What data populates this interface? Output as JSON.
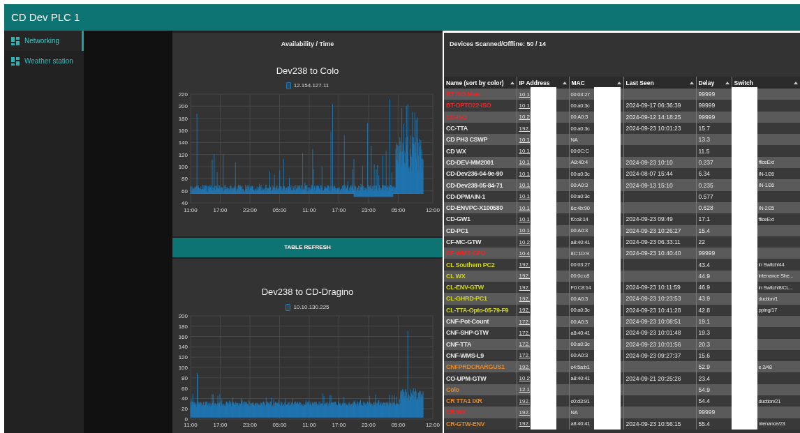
{
  "header": {
    "title": "CD Dev PLC 1"
  },
  "sidebar": {
    "items": [
      {
        "label": "Networking",
        "selected": true
      },
      {
        "label": "Weather station",
        "selected": false
      }
    ]
  },
  "availability": {
    "heading": "Availability / Time",
    "charts": [
      {
        "title": "Dev238 to Colo",
        "legend": "12.154.127.11",
        "yticks": [
          "220",
          "200",
          "180",
          "160",
          "140",
          "120",
          "100",
          "80",
          "60",
          "40"
        ],
        "xticks": [
          "11:00",
          "17:00",
          "23:00",
          "05:00",
          "11:00",
          "17:00",
          "23:00",
          "05:00",
          "12:00"
        ],
        "kind": "spiky"
      },
      {
        "title": "Dev238 to CD-Dragino",
        "legend": "10.10.130.225",
        "yticks": [
          "200",
          "180",
          "160",
          "140",
          "120",
          "100",
          "80",
          "60",
          "40",
          "20",
          "0"
        ],
        "xticks": [
          "11:00",
          "17:00",
          "23:00",
          "05:00",
          "11:00",
          "17:00",
          "23:00",
          "05:00",
          "12:00"
        ],
        "kind": "dense"
      }
    ],
    "refresh_button": "TABLE REFRESH"
  },
  "devices": {
    "heading": "Devices Scanned/Offline: 50 / 14",
    "columns": [
      "Name (sort by color)",
      "IP Address",
      "MAC",
      "Last Seen",
      "Delay",
      "Switch"
    ],
    "rows": [
      {
        "name": "BT ISO Main",
        "color": "#e8282b",
        "ip": "10.1",
        "mac": "00:03:27",
        "last_seen": "",
        "delay": "99999",
        "switch": ""
      },
      {
        "name": "BT-OPTO22-ISO",
        "color": "#e8282b",
        "ip": "10.1",
        "mac": "00:a0:3c",
        "last_seen": "2024-09-17 06:36:39",
        "delay": "99999",
        "switch": ""
      },
      {
        "name": "CC-ISO",
        "color": "#e8282b",
        "ip": "10.2",
        "mac": "00:A0:3",
        "last_seen": "2024-09-12 14:18:25",
        "delay": "99999",
        "switch": ""
      },
      {
        "name": "CC-TTA",
        "color": "#e6e6e6",
        "ip": "192.",
        "mac": "00:a0:3c",
        "last_seen": "2024-09-23 10:01:23",
        "delay": "15.7",
        "switch": ""
      },
      {
        "name": "CD PH3 CSWP",
        "color": "#e6e6e6",
        "ip": "10.1",
        "mac": "NA",
        "last_seen": "",
        "delay": "13.3",
        "switch": ""
      },
      {
        "name": "CD WX",
        "color": "#e6e6e6",
        "ip": "10.1",
        "mac": "00:0C:C",
        "last_seen": "",
        "delay": "11.5",
        "switch": ""
      },
      {
        "name": "CD-DEV-MM2001",
        "color": "#e6e6e6",
        "ip": "10.1",
        "mac": "A8:40:4",
        "last_seen": "2024-09-23 10:10",
        "delay": "0.237",
        "switch": "fficeExt"
      },
      {
        "name": "CD-Dev236-04-9e-90",
        "color": "#e6e6e6",
        "ip": "10.1",
        "mac": "00:a0:3c",
        "last_seen": "2024-08-07 15:44",
        "delay": "6.34",
        "switch": "IN-1/26"
      },
      {
        "name": "CD-Dev238-05-84-71",
        "color": "#e6e6e6",
        "ip": "10.1",
        "mac": "00:A0:3",
        "last_seen": "2024-09-13 15:10",
        "delay": "0.235",
        "switch": "IN-1/26"
      },
      {
        "name": "CD-DPMAIN-1",
        "color": "#e6e6e6",
        "ip": "10.1",
        "mac": "00:a0:3c",
        "last_seen": "",
        "delay": "0.577",
        "switch": ""
      },
      {
        "name": "CD-ENVPC-X100580",
        "color": "#e6e6e6",
        "ip": "10.1",
        "mac": "6c:4b:90",
        "last_seen": "",
        "delay": "0.628",
        "switch": "IN-2/25"
      },
      {
        "name": "CD-GW1",
        "color": "#e6e6e6",
        "ip": "10.1",
        "mac": "f0:c8:14",
        "last_seen": "2024-09-23 09:49",
        "delay": "17.1",
        "switch": "fficeExt"
      },
      {
        "name": "CD-PC1",
        "color": "#e6e6e6",
        "ip": "10.1",
        "mac": "00:A0:3",
        "last_seen": "2024-09-23 10:26:27",
        "delay": "15.4",
        "switch": ""
      },
      {
        "name": "CF-MC-GTW",
        "color": "#e6e6e6",
        "ip": "10.2",
        "mac": "a8:40:41",
        "last_seen": "2024-09-23 06:33:11",
        "delay": "22",
        "switch": ""
      },
      {
        "name": "CF-WMS-CPU",
        "color": "#e8282b",
        "ip": "10.4",
        "mac": "8C:1D:9",
        "last_seen": "2024-09-23 10:40:40",
        "delay": "99999",
        "switch": ""
      },
      {
        "name": "CL Southern PC2",
        "color": "#d2d61a",
        "ip": "192.",
        "mac": "00:03:27",
        "last_seen": "",
        "delay": "43.4",
        "switch": "in Switch/44"
      },
      {
        "name": "CL WX",
        "color": "#d2d61a",
        "ip": "192.",
        "mac": "00:0c:c8",
        "last_seen": "",
        "delay": "44.9",
        "switch": "intenance She..."
      },
      {
        "name": "CL-ENV-GTW",
        "color": "#d2d61a",
        "ip": "192.",
        "mac": "F0:C8:14",
        "last_seen": "2024-09-23 10:11:59",
        "delay": "46.9",
        "switch": "in Switch/8/CL..."
      },
      {
        "name": "CL-GHRD-PC1",
        "color": "#d2d61a",
        "ip": "192.",
        "mac": "00:A0:3",
        "last_seen": "2024-09-23 10:23:53",
        "delay": "43.9",
        "switch": "duction/1"
      },
      {
        "name": "CL-TTA-Opto-05-79-F9",
        "color": "#d2d61a",
        "ip": "192.",
        "mac": "00:a0:3c",
        "last_seen": "2024-09-23 10:41:28",
        "delay": "42.8",
        "switch": "pping/17"
      },
      {
        "name": "CNF-Pot-Count",
        "color": "#e6e6e6",
        "ip": "172.",
        "mac": "00:A0:3",
        "last_seen": "2024-09-23 10:08:51",
        "delay": "19.1",
        "switch": ""
      },
      {
        "name": "CNF-SHP-GTW",
        "color": "#e6e6e6",
        "ip": "172.",
        "mac": "a8:40:41",
        "last_seen": "2024-09-23 10:01:48",
        "delay": "19.3",
        "switch": ""
      },
      {
        "name": "CNF-TTA",
        "color": "#e6e6e6",
        "ip": "172.",
        "mac": "00:a0:3c",
        "last_seen": "2024-09-23 10:01:56",
        "delay": "20.3",
        "switch": ""
      },
      {
        "name": "CNF-WMS-L9",
        "color": "#e6e6e6",
        "ip": "172.",
        "mac": "00:A0:3",
        "last_seen": "2024-09-23 09:27:37",
        "delay": "15.6",
        "switch": ""
      },
      {
        "name": "CNFPRDCRARGUS1",
        "color": "#e0872a",
        "ip": "192.",
        "mac": "c4:5a:b1",
        "last_seen": "",
        "delay": "52.9",
        "switch": "e 2/48"
      },
      {
        "name": "CO-UPM-GTW",
        "color": "#e6e6e6",
        "ip": "10.2",
        "mac": "a8:40:41",
        "last_seen": "2024-09-21 20:25:26",
        "delay": "23.4",
        "switch": ""
      },
      {
        "name": "Colo",
        "color": "#e0872a",
        "ip": "12.1",
        "mac": "",
        "last_seen": "",
        "delay": "54.9",
        "switch": ""
      },
      {
        "name": "CR TTA1 IXR",
        "color": "#e0872a",
        "ip": "192.",
        "mac": "c0:d3:91",
        "last_seen": "",
        "delay": "54.4",
        "switch": "duction/21"
      },
      {
        "name": "CR WX",
        "color": "#e8282b",
        "ip": "192.",
        "mac": "NA",
        "last_seen": "",
        "delay": "99999",
        "switch": ""
      },
      {
        "name": "CR-GTW-ENV",
        "color": "#e0872a",
        "ip": "192.",
        "mac": "a8:40:41",
        "last_seen": "2024-09-23 10:56:15",
        "delay": "55.4",
        "switch": "ntenance/23"
      }
    ]
  }
}
